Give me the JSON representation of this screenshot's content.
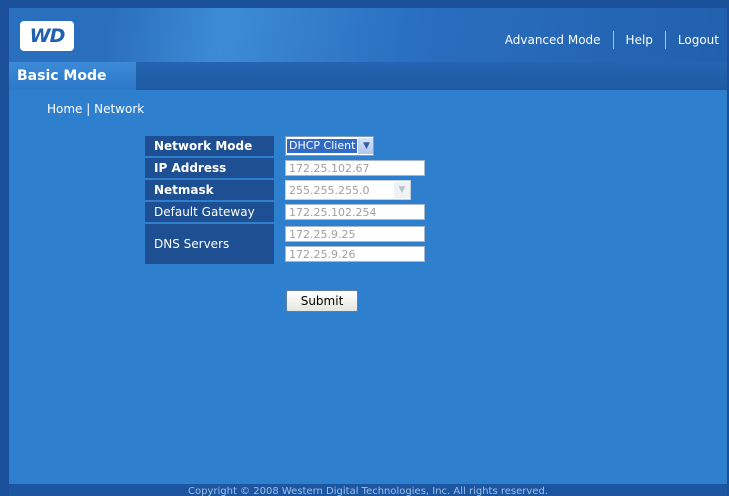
{
  "logo": {
    "text": "WD"
  },
  "header": {
    "links": [
      "Advanced Mode",
      "Help",
      "Logout"
    ]
  },
  "mode": {
    "label": "Basic Mode"
  },
  "breadcrumb": {
    "home": "Home",
    "separator": " | ",
    "current": "Network"
  },
  "form": {
    "network_mode": {
      "label": "Network Mode",
      "value": "DHCP Client"
    },
    "ip_address": {
      "label": "IP Address",
      "value": "172.25.102.67"
    },
    "netmask": {
      "label": "Netmask",
      "value": "255.255.255.0"
    },
    "gateway": {
      "label": "Default Gateway",
      "value": "172.25.102.254"
    },
    "dns": {
      "label": "DNS Servers",
      "primary": "172.25.9.25",
      "secondary": "172.25.9.26"
    },
    "submit_label": "Submit"
  },
  "footer": {
    "text": "Copyright © 2008 Western Digital Technologies, Inc. All rights reserved."
  },
  "colors": {
    "page_bg": "#2f7fcf",
    "label_bg": "#1d4f92",
    "header_bg": "#2a6fbd"
  }
}
